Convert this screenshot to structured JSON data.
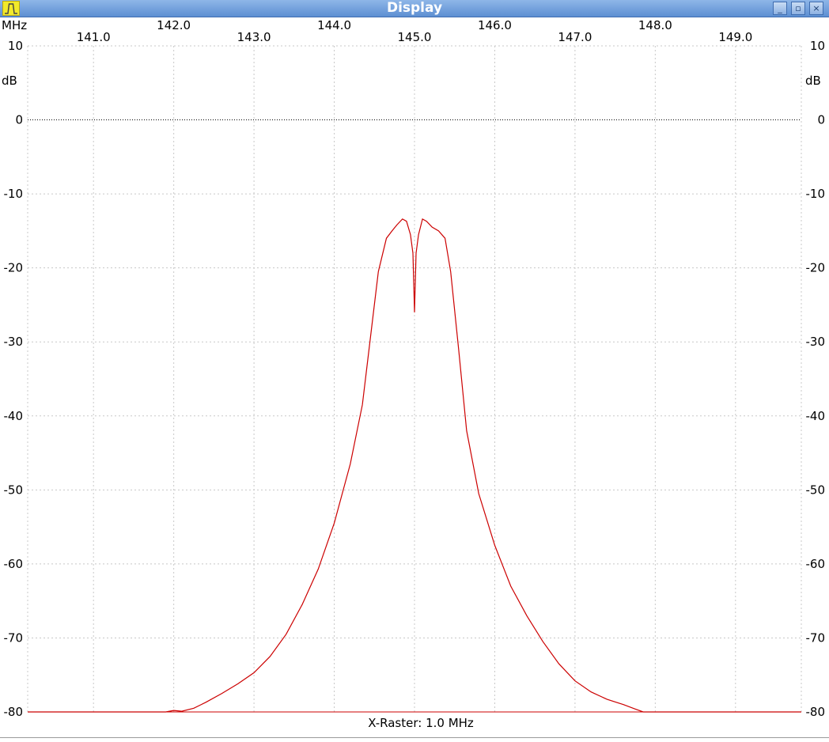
{
  "window": {
    "title": "Display",
    "min_label": "_",
    "max_label": "▫",
    "close_label": "×",
    "icon": "filter-passband-icon"
  },
  "chart_data": {
    "type": "line",
    "xunit": "MHz",
    "yunit": "dB",
    "xlim": [
      140.18,
      149.82
    ],
    "ylim": [
      -80,
      10
    ],
    "x_ticks": [
      "141.0",
      "142.0",
      "143.0",
      "144.0",
      "145.0",
      "146.0",
      "147.0",
      "148.0",
      "149.0"
    ],
    "x_tick_values": [
      141.0,
      142.0,
      143.0,
      144.0,
      145.0,
      146.0,
      147.0,
      148.0,
      149.0
    ],
    "y_ticks": [
      "10",
      "0",
      "-10",
      "-20",
      "-30",
      "-40",
      "-50",
      "-60",
      "-70",
      "-80"
    ],
    "y_tick_values": [
      10,
      0,
      -10,
      -20,
      -30,
      -40,
      -50,
      -60,
      -70,
      -80
    ],
    "reference_line": 0,
    "grid": true,
    "footer": "X-Raster: 1.0 MHz",
    "series": [
      {
        "color": "#cc0000",
        "x": [
          140.18,
          141.0,
          141.5,
          141.9,
          142.0,
          142.1,
          142.25,
          142.4,
          142.6,
          142.8,
          143.0,
          143.2,
          143.4,
          143.6,
          143.8,
          144.0,
          144.2,
          144.35,
          144.45,
          144.55,
          144.65,
          144.72,
          144.78,
          144.85,
          144.9,
          144.95,
          144.98,
          145.0,
          145.02,
          145.05,
          145.1,
          145.15,
          145.22,
          145.3,
          145.38,
          145.45,
          145.55,
          145.65,
          145.8,
          146.0,
          146.2,
          146.4,
          146.6,
          146.8,
          147.0,
          147.2,
          147.4,
          147.6,
          147.75,
          147.85,
          148.0,
          148.5,
          149.0,
          149.82
        ],
        "y": [
          -80,
          -80,
          -80,
          -80,
          -79.8,
          -79.9,
          -79.5,
          -78.7,
          -77.5,
          -76.2,
          -74.7,
          -72.5,
          -69.5,
          -65.5,
          -60.7,
          -54.5,
          -46.5,
          -38.5,
          -29.5,
          -20.5,
          -16.0,
          -15.0,
          -14.2,
          -13.4,
          -13.7,
          -15.5,
          -18.0,
          -26.0,
          -18.0,
          -15.5,
          -13.4,
          -13.7,
          -14.5,
          -15.0,
          -16.0,
          -20.5,
          -31.0,
          -42.0,
          -50.5,
          -57.5,
          -63.0,
          -67.0,
          -70.5,
          -73.5,
          -75.8,
          -77.3,
          -78.3,
          -79.0,
          -79.6,
          -80,
          -80,
          -80,
          -80,
          -80
        ]
      }
    ]
  }
}
